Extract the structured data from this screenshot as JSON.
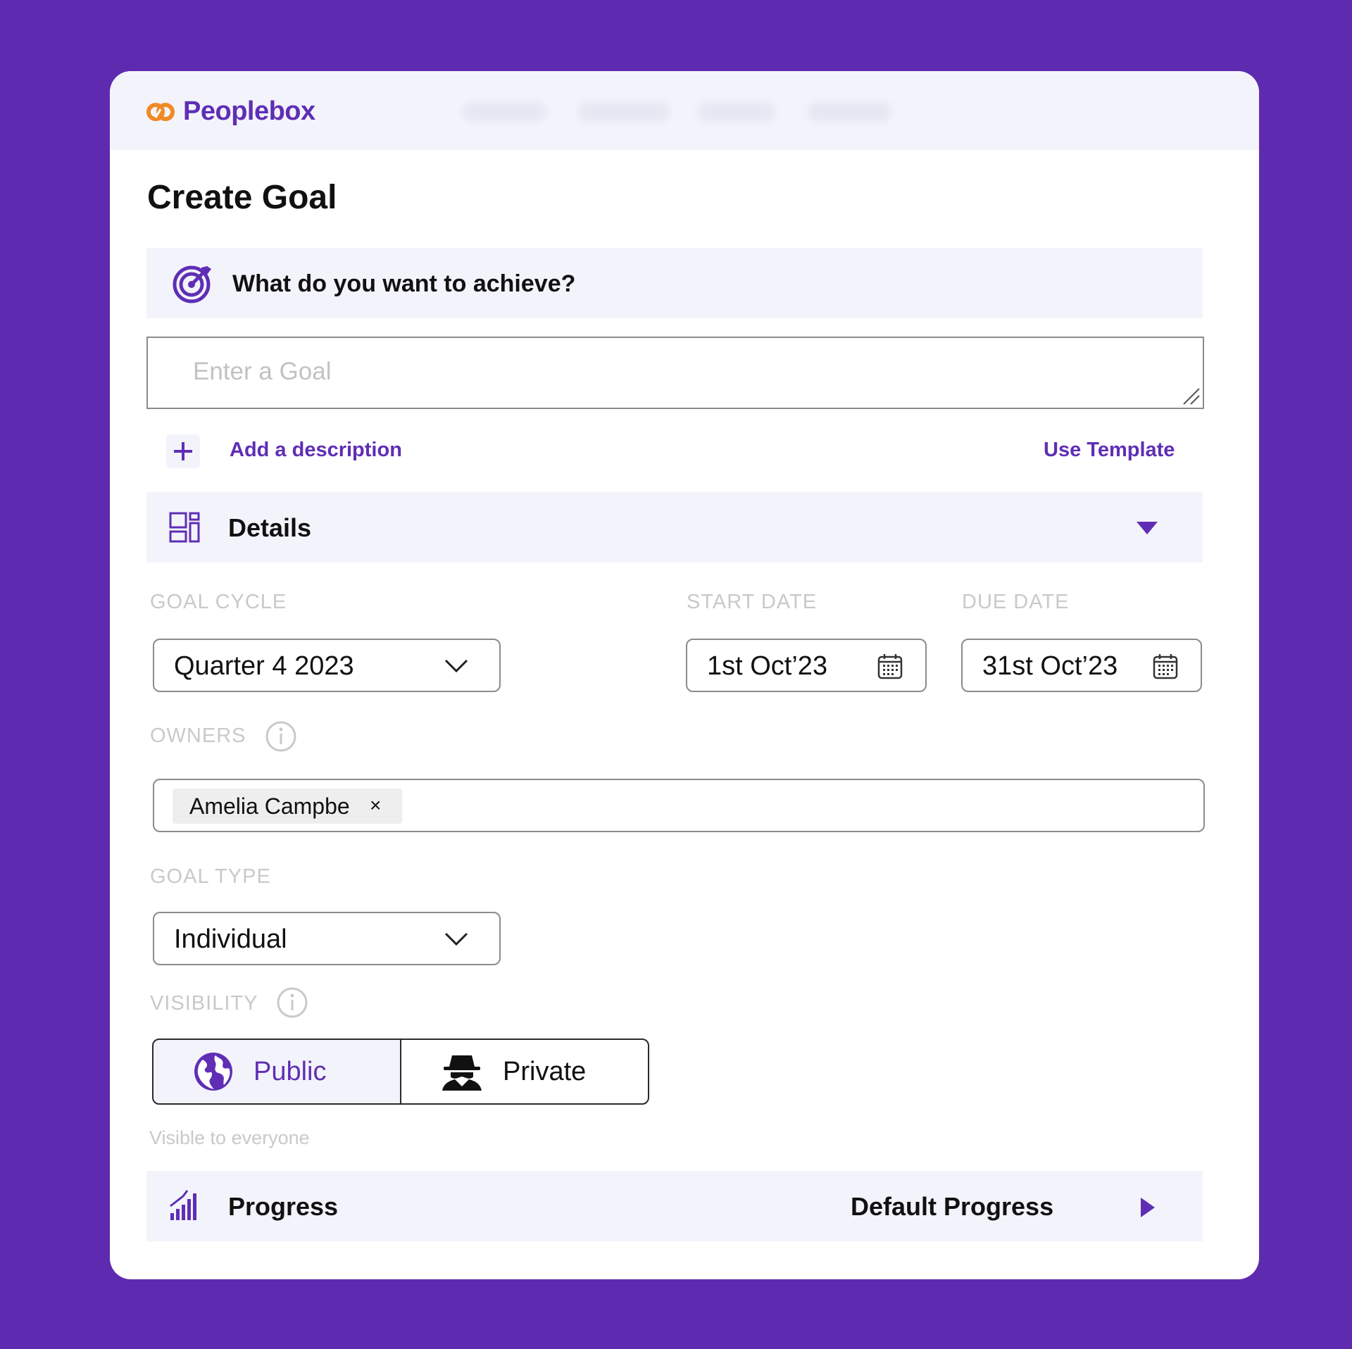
{
  "app": {
    "name": "Peoplebox"
  },
  "page": {
    "title": "Create Goal"
  },
  "goal_section": {
    "title": "What do you want to achieve?",
    "input_placeholder": "Enter a Goal",
    "add_description": "Add a description",
    "use_template": "Use Template"
  },
  "details": {
    "title": "Details",
    "goal_cycle": {
      "label": "GOAL CYCLE",
      "value": "Quarter 4 2023"
    },
    "start_date": {
      "label": "START DATE",
      "value": "1st Oct’23"
    },
    "due_date": {
      "label": "DUE DATE",
      "value": "31st Oct’23"
    },
    "owners": {
      "label": "OWNERS",
      "chips": [
        "Amelia Campbe"
      ],
      "remove_glyph": "×"
    },
    "goal_type": {
      "label": "GOAL TYPE",
      "value": "Individual"
    },
    "visibility": {
      "label": "VISIBILITY",
      "options": [
        "Public",
        "Private"
      ],
      "selected": "Public",
      "helper": "Visible to everyone"
    }
  },
  "progress": {
    "title": "Progress",
    "value": "Default Progress"
  },
  "colors": {
    "brand": "#5f2eb5",
    "background": "#5e2bb0",
    "logo_accent": "#f08a24",
    "band": "#f3f4fb"
  },
  "icons": [
    "logo-icon",
    "target-icon",
    "plus-icon",
    "dashboard-icon",
    "caret-down-icon",
    "chevron-down-icon",
    "calendar-icon",
    "info-icon",
    "globe-icon",
    "spy-icon",
    "signal-bars-icon",
    "caret-right-icon",
    "resize-handle-icon"
  ]
}
